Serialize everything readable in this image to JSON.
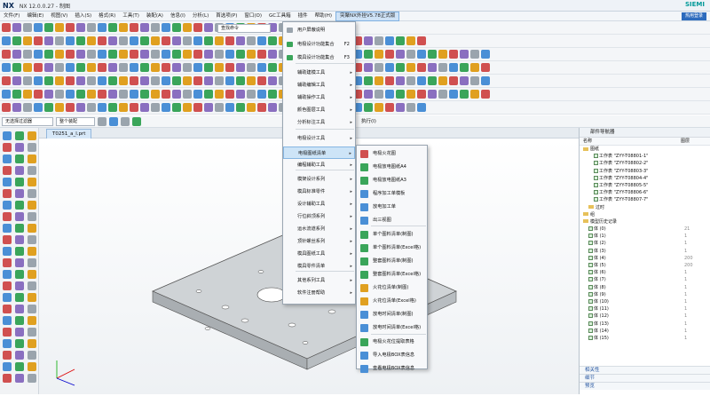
{
  "window": {
    "logo": "NX",
    "title": "NX 12.0.0.27 - 制图",
    "brand": "SIEMI"
  },
  "menubar": {
    "items": [
      "文件(F)",
      "编辑(E)",
      "视图(V)",
      "插入(S)",
      "格式(R)",
      "工具(T)",
      "装配(A)",
      "信息(I)",
      "分析(L)",
      "首选项(P)",
      "窗口(O)",
      "GC工具箱",
      "插件",
      "帮助(H)",
      "突聚NX外挂V5.78正式版"
    ],
    "active_index": 14,
    "login_label": "热用登录"
  },
  "filterbar": {
    "filter_combo": "无选择过滤器",
    "assembly_combo": "整个装配",
    "exec_label": "执行(I)",
    "search_placeholder": "查找命令"
  },
  "document": {
    "tab_label": "T0251_a_l.prt"
  },
  "menu_main": {
    "items": [
      {
        "label": "用户屏蔽说明",
        "key": "",
        "submenu": false
      },
      {
        "label": "电极设计功能集合",
        "key": "F2",
        "submenu": false
      },
      {
        "label": "模具设计功能集合",
        "key": "F3",
        "submenu": false
      },
      {
        "label": "辅助建模工具",
        "key": "",
        "submenu": true
      },
      {
        "label": "辅助编辑工具",
        "key": "",
        "submenu": true
      },
      {
        "label": "辅助操作工具",
        "key": "",
        "submenu": true
      },
      {
        "label": "颜色图层工具",
        "key": "",
        "submenu": true
      },
      {
        "label": "分析标注工具",
        "key": "",
        "submenu": true
      },
      {
        "label": "电极设计工具",
        "key": "",
        "submenu": true
      },
      {
        "label": "电极图纸清单",
        "key": "",
        "submenu": true
      },
      {
        "label": "编程辅助工具",
        "key": "",
        "submenu": true
      },
      {
        "label": "模架设计系列",
        "key": "",
        "submenu": true
      },
      {
        "label": "模具标准零件",
        "key": "",
        "submenu": true
      },
      {
        "label": "设计辅助工具",
        "key": "",
        "submenu": true
      },
      {
        "label": "行位斜顶系列",
        "key": "",
        "submenu": true
      },
      {
        "label": "运水流道系列",
        "key": "",
        "submenu": true
      },
      {
        "label": "顶针螺丝系列",
        "key": "",
        "submenu": true
      },
      {
        "label": "模具图纸工具",
        "key": "",
        "submenu": true
      },
      {
        "label": "模具零件清单",
        "key": "",
        "submenu": true
      },
      {
        "label": "其他系列工具",
        "key": "",
        "submenu": true
      },
      {
        "label": "软件注册帮助",
        "key": "",
        "submenu": true
      }
    ],
    "highlight_index": 9
  },
  "menu_sub": {
    "items": [
      "电极火花图",
      "电极放电图纸A4",
      "电极放电图纸A3",
      "程序加工单模板",
      "放电加工单",
      "出三视图",
      "单个图料清单(制图)",
      "单个图料清单(Excel格)",
      "整套图料清单(制图)",
      "整套图料清单(Excel格)",
      "火花位清单(制图)",
      "火花位清单(Excel格)",
      "放电时间清单(制图)",
      "放电时间清单(Excel格)",
      "电极火花位提取表格",
      "导入电极BOX表信息",
      "查看电极BOX表信息"
    ]
  },
  "navigator": {
    "title": "部件导航器",
    "col_name": "名称",
    "col_layer": "图层",
    "rows": [
      {
        "indent": 0,
        "label": "图纸",
        "value": "",
        "type": "folder"
      },
      {
        "indent": 2,
        "label": "工作表 \"ZYY-T08801-1\"",
        "value": "",
        "type": "sheet"
      },
      {
        "indent": 2,
        "label": "工作表 \"ZYY-T08802-2\"",
        "value": "",
        "type": "sheet"
      },
      {
        "indent": 2,
        "label": "工作表 \"ZYY-T08803-3\"",
        "value": "",
        "type": "sheet"
      },
      {
        "indent": 2,
        "label": "工作表 \"ZYY-T08804-4\"",
        "value": "",
        "type": "sheet"
      },
      {
        "indent": 2,
        "label": "工作表 \"ZYY-T08805-5\"",
        "value": "",
        "type": "sheet"
      },
      {
        "indent": 2,
        "label": "工作表 \"ZYY-T08806-6\"",
        "value": "",
        "type": "sheet"
      },
      {
        "indent": 2,
        "label": "工作表 \"ZYY-T08807-7\"",
        "value": "",
        "type": "sheet"
      },
      {
        "indent": 1,
        "label": "过时",
        "value": "",
        "type": "folder"
      },
      {
        "indent": 0,
        "label": "组",
        "value": "",
        "type": "folder"
      },
      {
        "indent": 0,
        "label": "模型历史记录",
        "value": "",
        "type": "folder"
      },
      {
        "indent": 1,
        "label": "体 (0)",
        "value": "21",
        "type": "item"
      },
      {
        "indent": 1,
        "label": "体 (1)",
        "value": "1",
        "type": "item"
      },
      {
        "indent": 1,
        "label": "体 (2)",
        "value": "1",
        "type": "item"
      },
      {
        "indent": 1,
        "label": "体 (3)",
        "value": "1",
        "type": "item"
      },
      {
        "indent": 1,
        "label": "体 (4)",
        "value": "200",
        "type": "item"
      },
      {
        "indent": 1,
        "label": "体 (5)",
        "value": "200",
        "type": "item"
      },
      {
        "indent": 1,
        "label": "体 (6)",
        "value": "1",
        "type": "item"
      },
      {
        "indent": 1,
        "label": "体 (7)",
        "value": "1",
        "type": "item"
      },
      {
        "indent": 1,
        "label": "体 (8)",
        "value": "1",
        "type": "item"
      },
      {
        "indent": 1,
        "label": "体 (9)",
        "value": "1",
        "type": "item"
      },
      {
        "indent": 1,
        "label": "体 (10)",
        "value": "1",
        "type": "item"
      },
      {
        "indent": 1,
        "label": "体 (11)",
        "value": "1",
        "type": "item"
      },
      {
        "indent": 1,
        "label": "体 (12)",
        "value": "1",
        "type": "item"
      },
      {
        "indent": 1,
        "label": "体 (13)",
        "value": "1",
        "type": "item"
      },
      {
        "indent": 1,
        "label": "体 (14)",
        "value": "1",
        "type": "item"
      },
      {
        "indent": 1,
        "label": "体 (15)",
        "value": "1",
        "type": "item"
      }
    ],
    "footer": [
      "相关性",
      "细节",
      "预览"
    ]
  }
}
